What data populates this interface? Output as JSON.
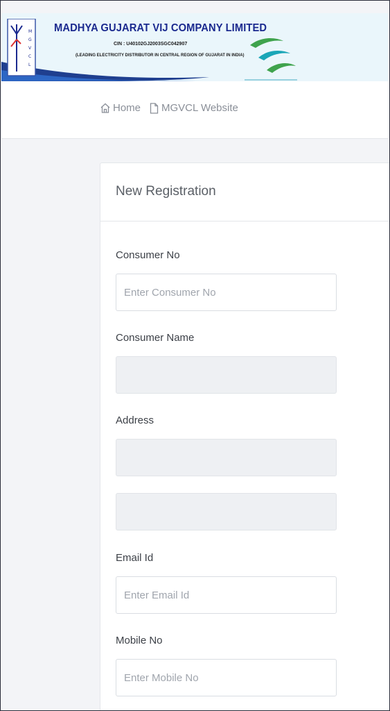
{
  "header": {
    "company_name": "MADHYA GUJARAT VIJ COMPANY LIMITED",
    "cin": "CIN : U40102GJ2003SGC042907",
    "tagline": "(LEADING ELECTRICITY DISTRIBUTOR IN CENTRAL REGION OF GUJARAT IN INDIA)",
    "logo_text": "MGVCL"
  },
  "nav": {
    "home": "Home",
    "website": "MGVCL Website"
  },
  "form": {
    "title": "New Registration",
    "consumer_no_label": "Consumer No",
    "consumer_no_placeholder": "Enter Consumer No",
    "consumer_name_label": "Consumer Name",
    "consumer_name_value": "",
    "address_label": "Address",
    "address_line1_value": "",
    "address_line2_value": "",
    "email_label": "Email Id",
    "email_placeholder": "Enter Email Id",
    "mobile_label": "Mobile No",
    "mobile_placeholder": "Enter Mobile No"
  },
  "colors": {
    "brand_blue": "#1b2a8f",
    "banner_bg": "#eaf6fb",
    "swoosh": "#1f3f8f",
    "bird_green": "#3fa34d",
    "bird_teal": "#1aa6b7"
  }
}
